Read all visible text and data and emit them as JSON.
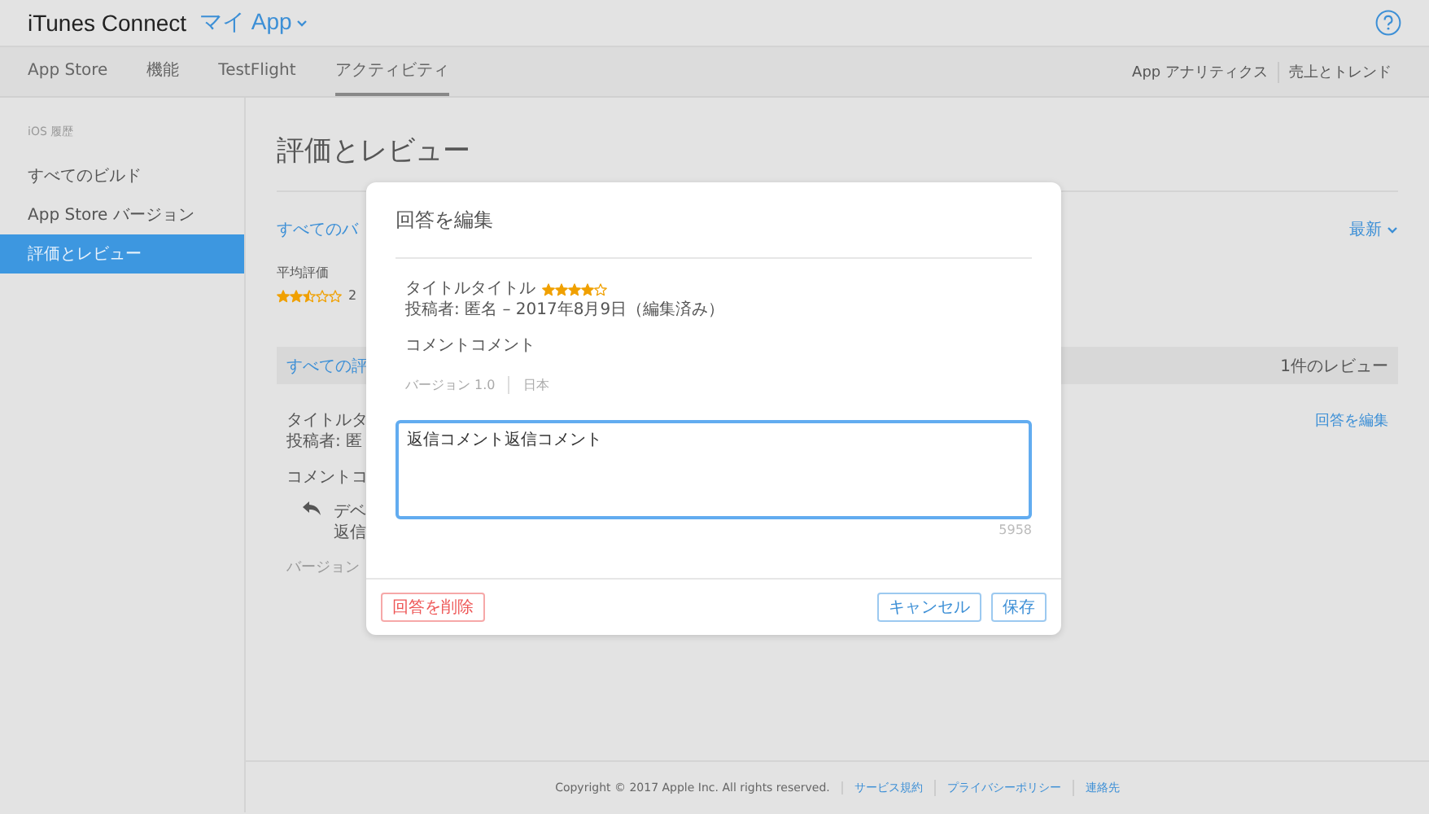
{
  "header": {
    "brand": "iTunes Connect",
    "app_menu": "マイ App"
  },
  "nav": {
    "tabs": [
      {
        "label": "App Store",
        "selected": false
      },
      {
        "label": "機能",
        "selected": false
      },
      {
        "label": "TestFlight",
        "selected": false
      },
      {
        "label": "アクティビティ",
        "selected": true
      }
    ],
    "links": [
      "App アナリティクス",
      "売上とトレンド"
    ]
  },
  "sidebar": {
    "heading": "iOS 履歴",
    "items": [
      {
        "label": "すべてのビルド",
        "selected": false
      },
      {
        "label": "App Store バージョン",
        "selected": false
      },
      {
        "label": "評価とレビュー",
        "selected": true
      }
    ]
  },
  "page": {
    "title": "評価とレビュー",
    "filter_link": "すべてのバ",
    "sort": "最新",
    "average_label": "平均評価",
    "average": {
      "stars": 2.5,
      "count": "2"
    },
    "review_bar": {
      "label": "すべての評",
      "count": "1件のレビュー"
    },
    "review": {
      "title": "タイトルタ",
      "author": "投稿者: 匿",
      "body": "コメントコ",
      "reply_lines": [
        "デベ",
        "返信"
      ],
      "version": "バージョン",
      "edit_link": "回答を編集"
    }
  },
  "dialog": {
    "title": "回答を編集",
    "review_title": "タイトルタイトル",
    "stars": 4,
    "author": "投稿者: 匿名 – 2017年8月9日（編集済み）",
    "body": "コメントコメント",
    "version": "バージョン 1.0",
    "country": "日本",
    "reply": "返信コメント返信コメント",
    "remaining": "5958",
    "buttons": [
      {
        "kind": "danger",
        "label": "回答を削除"
      },
      {
        "kind": "secondary",
        "label": "キャンセル"
      },
      {
        "kind": "primary",
        "label": "保存"
      }
    ]
  },
  "footer": {
    "copyright": "Copyright © 2017 Apple Inc. All rights reserved.",
    "links": [
      "サービス規約",
      "プライバシーポリシー",
      "連絡先"
    ]
  }
}
